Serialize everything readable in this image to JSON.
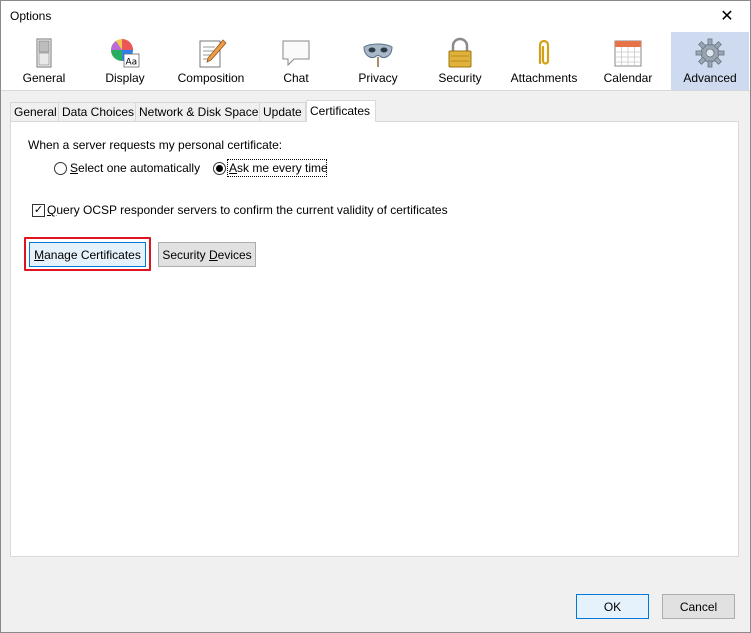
{
  "window": {
    "title": "Options",
    "close_glyph": "✕"
  },
  "toolbar": {
    "items": [
      {
        "label": "General",
        "icon": "switch-icon"
      },
      {
        "label": "Display",
        "icon": "color-palette-icon"
      },
      {
        "label": "Composition",
        "icon": "notepad-pencil-icon"
      },
      {
        "label": "Chat",
        "icon": "speech-bubble-icon"
      },
      {
        "label": "Privacy",
        "icon": "mask-icon"
      },
      {
        "label": "Security",
        "icon": "padlock-icon"
      },
      {
        "label": "Attachments",
        "icon": "paperclip-icon"
      },
      {
        "label": "Calendar",
        "icon": "calendar-icon"
      },
      {
        "label": "Advanced",
        "icon": "gear-icon"
      }
    ],
    "selected": "Advanced"
  },
  "tabs": {
    "items": [
      "General",
      "Data Choices",
      "Network & Disk Space",
      "Update",
      "Certificates"
    ],
    "active": "Certificates"
  },
  "certificates": {
    "request_label": "When a server requests my personal certificate:",
    "radio_auto": {
      "prefix": "",
      "mnemonic": "S",
      "rest": "elect one automatically",
      "checked": false
    },
    "radio_ask": {
      "prefix": "",
      "mnemonic": "A",
      "rest": "sk me every time",
      "checked": true
    },
    "ocsp": {
      "mnemonic": "Q",
      "rest": "uery OCSP responder servers to confirm the current validity of certificates",
      "checked": true
    },
    "manage_button": {
      "mnemonic": "M",
      "rest": "anage Certificates"
    },
    "devices_button": {
      "prefix": "Security ",
      "mnemonic": "D",
      "rest": "evices"
    }
  },
  "footer": {
    "ok_label": "OK",
    "cancel_label": "Cancel"
  },
  "colors": {
    "accent": "#0078d7",
    "highlight": "#e0141e",
    "selected_tab_bg": "#cddaf0"
  }
}
